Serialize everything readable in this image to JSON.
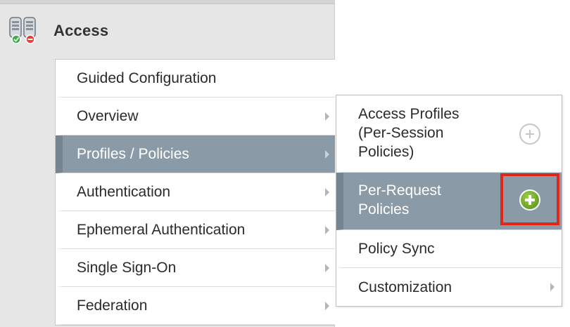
{
  "section": {
    "title": "Access",
    "icon": "access-servers-icon"
  },
  "menu": {
    "items": [
      {
        "label": "Guided Configuration",
        "has_submenu": false,
        "active": false
      },
      {
        "label": "Overview",
        "has_submenu": true,
        "active": false
      },
      {
        "label": "Profiles / Policies",
        "has_submenu": true,
        "active": true
      },
      {
        "label": "Authentication",
        "has_submenu": true,
        "active": false
      },
      {
        "label": "Ephemeral Authentication",
        "has_submenu": true,
        "active": false
      },
      {
        "label": "Single Sign-On",
        "has_submenu": true,
        "active": false
      },
      {
        "label": "Federation",
        "has_submenu": true,
        "active": false
      }
    ]
  },
  "submenu": {
    "items": [
      {
        "label_lines": [
          "Access Profiles",
          "(Per-Session",
          "Policies)"
        ],
        "action_icon": "plus-circle-icon"
      },
      {
        "label_lines": [
          "Per-Request",
          "Policies"
        ],
        "action_icon": "plus-circle-icon",
        "active": true,
        "highlighted": true
      },
      {
        "label": "Policy Sync"
      },
      {
        "label": "Customization",
        "has_submenu": true
      }
    ]
  },
  "colors": {
    "active_bg": "#8b9aa7",
    "highlight_border": "#e0261b",
    "create_icon_green": "#6ea62b"
  }
}
